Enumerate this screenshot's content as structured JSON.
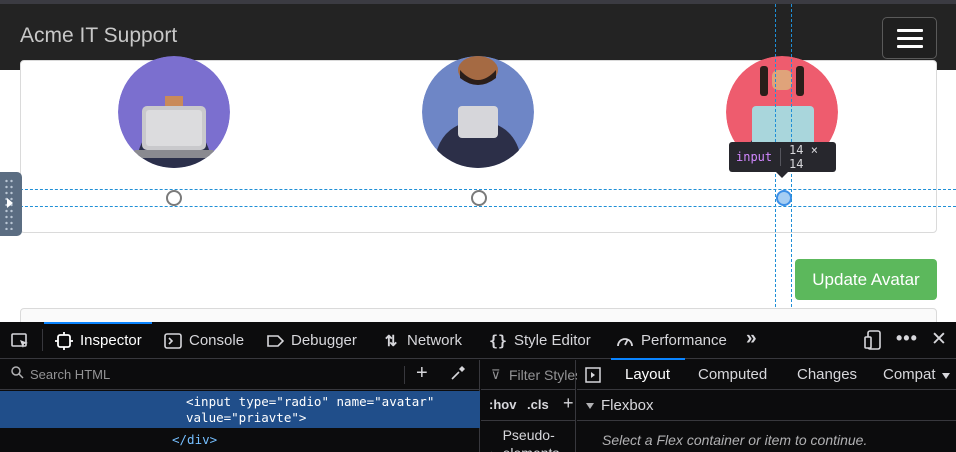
{
  "page": {
    "brand": "Acme IT Support",
    "update_button": "Update Avatar",
    "avatars": [
      {
        "name": "avatar-purple",
        "bg": "#7b6fcf",
        "skin": "#c98a5a",
        "suit": "#2b2f4a",
        "tie": "#3a7fc0",
        "selected": false
      },
      {
        "name": "avatar-blue",
        "bg": "#6e86c6",
        "skin": "#a56a43",
        "suit": "#2c2f48",
        "tie": "#b6222a",
        "selected": false
      },
      {
        "name": "avatar-pink",
        "bg": "#ee5c6e",
        "skin": "#e0a37a",
        "suit": "#2c2f48",
        "tie": "#ffffff",
        "selected": true
      }
    ]
  },
  "inspector_tooltip": {
    "tag": "input",
    "dims": "14 × 14"
  },
  "devtools": {
    "tabs": [
      {
        "label": "Inspector",
        "icon": "inspector-icon",
        "active": true
      },
      {
        "label": "Console",
        "icon": "console-icon",
        "active": false
      },
      {
        "label": "Debugger",
        "icon": "debugger-icon",
        "active": false
      },
      {
        "label": "Network",
        "icon": "network-icon",
        "active": false
      },
      {
        "label": "Style Editor",
        "icon": "style-editor-icon",
        "active": false
      },
      {
        "label": "Performance",
        "icon": "performance-icon",
        "active": false
      }
    ],
    "search_placeholder": "Search HTML",
    "html": {
      "selected_line_1": "<input type=\"radio\" name=\"avatar\"",
      "selected_line_2": "value=\"priavte\">",
      "next_line": "</div>"
    },
    "rules": {
      "filter_placeholder": "Filter Styles",
      "hov": ":hov",
      "cls": ".cls",
      "pseudo": "Pseudo-elements"
    },
    "right_tabs": {
      "layout": "Layout",
      "computed": "Computed",
      "changes": "Changes",
      "compat": "Compat"
    },
    "flexbox": {
      "header": "Flexbox",
      "message": "Select a Flex container or item to continue."
    },
    "colors": {
      "accent": "#0a84ff",
      "selection": "#204e8a"
    }
  }
}
